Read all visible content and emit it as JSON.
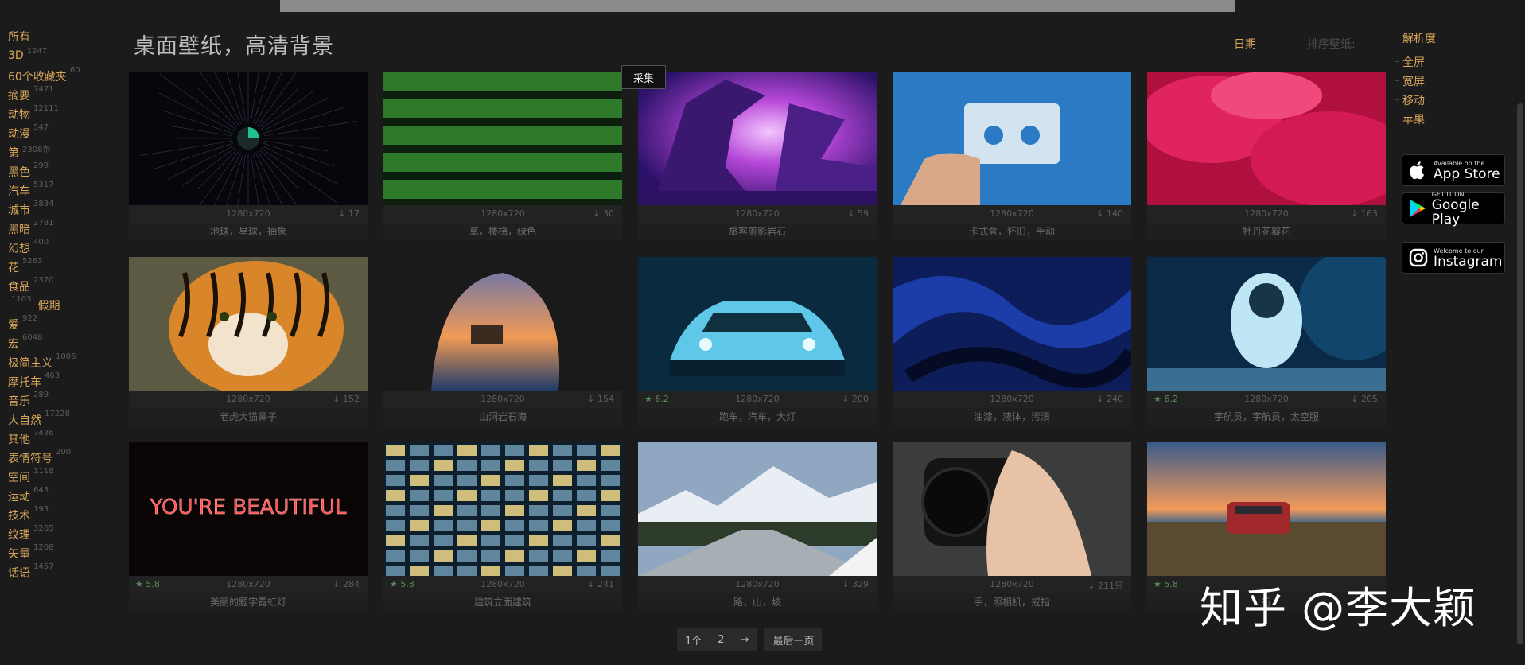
{
  "header": {
    "title": "桌面壁纸，高清背景",
    "sort_date": "日期",
    "sort_label": "排序壁纸:"
  },
  "tooltip": {
    "collect": "采集"
  },
  "sidebar": {
    "all_label": "所有",
    "categories": [
      {
        "name": "3D",
        "count": "1247"
      },
      {
        "name": "60个收藏夹",
        "count": "60"
      },
      {
        "name": "摘要",
        "count": "7471"
      },
      {
        "name": "动物",
        "count": "12111"
      },
      {
        "name": "动漫",
        "count": "547"
      },
      {
        "name": "第",
        "count": "2308条"
      },
      {
        "name": "黑色",
        "count": "299"
      },
      {
        "name": "汽车",
        "count": "5317"
      },
      {
        "name": "城市",
        "count": "3834"
      },
      {
        "name": "黑暗",
        "count": "2781"
      },
      {
        "name": "幻想",
        "count": "400"
      },
      {
        "name": "花",
        "count": "5263"
      },
      {
        "name": "食品",
        "count": "2370"
      },
      {
        "name": "假期",
        "count": "1103"
      },
      {
        "name": "爱",
        "count": "922"
      },
      {
        "name": "宏",
        "count": "6048"
      },
      {
        "name": "极简主义",
        "count": "1006"
      },
      {
        "name": "摩托车",
        "count": "463"
      },
      {
        "name": "音乐",
        "count": "289"
      },
      {
        "name": "大自然",
        "count": "17228"
      },
      {
        "name": "其他",
        "count": "7436"
      },
      {
        "name": "表情符号",
        "count": "200"
      },
      {
        "name": "空间",
        "count": "1118"
      },
      {
        "name": "运动",
        "count": "643"
      },
      {
        "name": "技术",
        "count": "193"
      },
      {
        "name": "纹理",
        "count": "3265"
      },
      {
        "name": "矢量",
        "count": "1208"
      },
      {
        "name": "话语",
        "count": "1457"
      }
    ]
  },
  "wallpapers": [
    {
      "res": "1280x720",
      "rating": "",
      "downloads": "17",
      "tags": "地球，星球，抽象",
      "icon": "earth-image"
    },
    {
      "res": "1280x720",
      "rating": "",
      "downloads": "30",
      "tags": "草，楼梯，绿色",
      "icon": "grass-steps-image"
    },
    {
      "res": "1280x720",
      "rating": "",
      "downloads": "59",
      "tags": "旅客剪影岩石",
      "icon": "silhouette-rock-image"
    },
    {
      "res": "1280x720",
      "rating": "",
      "downloads": "140",
      "tags": "卡式盒，怀旧，手动",
      "icon": "cassette-image"
    },
    {
      "res": "1280x720",
      "rating": "",
      "downloads": "163",
      "tags": "牡丹花瓣花",
      "icon": "peony-image"
    },
    {
      "res": "1280x720",
      "rating": "",
      "downloads": "152",
      "tags": "老虎大猫鼻子",
      "icon": "tiger-image"
    },
    {
      "res": "1280x720",
      "rating": "",
      "downloads": "154",
      "tags": "山洞岩石海",
      "icon": "cave-sea-image"
    },
    {
      "res": "1280x720",
      "rating": "6.2",
      "downloads": "200",
      "tags": "跑车，汽车，大灯",
      "icon": "sports-car-image"
    },
    {
      "res": "1280x720",
      "rating": "",
      "downloads": "240",
      "tags": "油漆，液体，污渍",
      "icon": "paint-image"
    },
    {
      "res": "1280x720",
      "rating": "6.2",
      "downloads": "205",
      "tags": "宇航员，宇航员，太空服",
      "icon": "astronaut-image"
    },
    {
      "res": "1280x720",
      "rating": "5.8",
      "downloads": "284",
      "tags": "美丽的题字霓虹灯",
      "icon": "neon-image",
      "neon_text": "YOU'RE BEAUTIFUL"
    },
    {
      "res": "1280x720",
      "rating": "5.8",
      "downloads": "241",
      "tags": "建筑立面建筑",
      "icon": "building-image"
    },
    {
      "res": "1280x720",
      "rating": "",
      "downloads": "329",
      "tags": "路，山，坡",
      "icon": "mountain-road-image"
    },
    {
      "res": "1280x720",
      "rating": "",
      "downloads": "211只",
      "tags": "手，照相机，戒指",
      "icon": "camera-hand-image"
    },
    {
      "res": "",
      "rating": "5.8",
      "downloads": "",
      "tags": "行",
      "icon": "van-sunset-image"
    }
  ],
  "resolution_panel": {
    "head": "解析度",
    "items": [
      "全屏",
      "宽屏",
      "移动",
      "苹果"
    ]
  },
  "badges": {
    "appstore_small": "Available on the",
    "appstore_big": "App Store",
    "gplay_small": "GET IT ON",
    "gplay_big": "Google Play",
    "insta_small": "Welcome to our",
    "insta_big": "Instagram"
  },
  "pagination": {
    "current": "1个",
    "page2": "2",
    "next": "→",
    "last": "最后一页"
  },
  "watermark": "知乎 @李大颖"
}
